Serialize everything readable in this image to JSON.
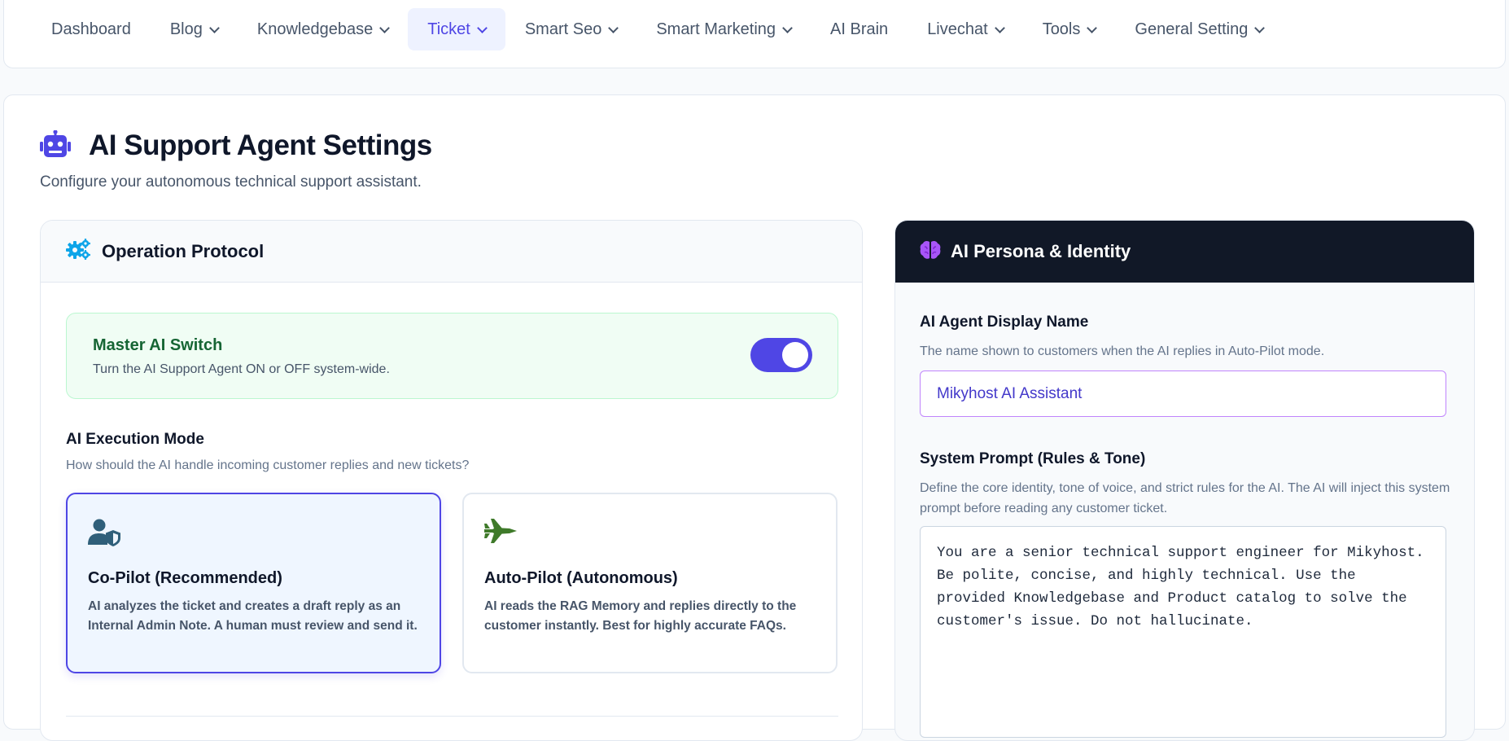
{
  "nav": {
    "items": [
      {
        "label": "Dashboard",
        "dropdown": false,
        "active": false
      },
      {
        "label": "Blog",
        "dropdown": true,
        "active": false
      },
      {
        "label": "Knowledgebase",
        "dropdown": true,
        "active": false
      },
      {
        "label": "Ticket",
        "dropdown": true,
        "active": true
      },
      {
        "label": "Smart Seo",
        "dropdown": true,
        "active": false
      },
      {
        "label": "Smart Marketing",
        "dropdown": true,
        "active": false
      },
      {
        "label": "AI Brain",
        "dropdown": false,
        "active": false
      },
      {
        "label": "Livechat",
        "dropdown": true,
        "active": false
      },
      {
        "label": "Tools",
        "dropdown": true,
        "active": false
      },
      {
        "label": "General Setting",
        "dropdown": true,
        "active": false
      }
    ]
  },
  "page": {
    "title": "AI Support Agent Settings",
    "subtitle": "Configure your autonomous technical support assistant.",
    "title_icon": "robot-icon"
  },
  "operation": {
    "title": "Operation Protocol",
    "icon": "gears-icon",
    "master_switch": {
      "title": "Master AI Switch",
      "description": "Turn the AI Support Agent ON or OFF system-wide.",
      "enabled": true
    },
    "execution_mode": {
      "label": "AI Execution Mode",
      "help": "How should the AI handle incoming customer replies and new tickets?",
      "selected": "copilot",
      "options": {
        "copilot": {
          "icon": "user-shield-icon",
          "title": "Co-Pilot (Recommended)",
          "description": "AI analyzes the ticket and creates a draft reply as an Internal Admin Note. A human must review and send it."
        },
        "autopilot": {
          "icon": "fighter-jet-icon",
          "title": "Auto-Pilot (Autonomous)",
          "description": "AI reads the RAG Memory and replies directly to the customer instantly. Best for highly accurate FAQs."
        }
      }
    }
  },
  "persona": {
    "title": "AI Persona & Identity",
    "icon": "brain-icon",
    "display_name": {
      "label": "AI Agent Display Name",
      "help": "The name shown to customers when the AI replies in Auto-Pilot mode.",
      "value": "Mikyhost AI Assistant"
    },
    "system_prompt": {
      "label": "System Prompt (Rules & Tone)",
      "help": "Define the core identity, tone of voice, and strict rules for the AI. The AI will inject this system prompt before reading any customer ticket.",
      "value": "You are a senior technical support engineer for Mikyhost. Be polite, concise, and highly technical. Use the provided Knowledgebase and Product catalog to solve the customer's issue. Do not hallucinate."
    }
  },
  "colors": {
    "accent": "#4f46e5",
    "success_bg": "#f0fdf4",
    "success_text": "#166534",
    "dark_header": "#111827",
    "brain": "#a855f7",
    "gear": "#0ea5e9",
    "jet": "#3f7a2a",
    "user_shield": "#2f5f7a"
  }
}
